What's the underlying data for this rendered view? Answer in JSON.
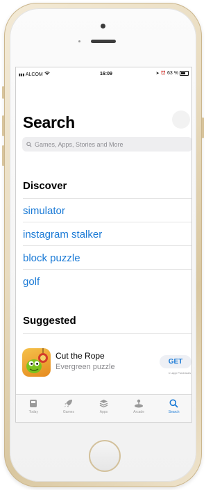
{
  "status": {
    "carrier": "ALCOM",
    "time": "16:09",
    "battery": "63 %"
  },
  "page": {
    "title": "Search"
  },
  "search": {
    "placeholder": "Games, Apps, Stories and More"
  },
  "discover": {
    "heading": "Discover",
    "items": [
      "simulator",
      "instagram stalker",
      "block puzzle",
      "golf"
    ]
  },
  "suggested": {
    "heading": "Suggested",
    "app": {
      "name": "Cut the Rope",
      "subtitle": "Evergreen puzzle",
      "button": "GET",
      "note": "In-App Purchases"
    }
  },
  "tabs": [
    {
      "label": "Today",
      "icon": "today-icon"
    },
    {
      "label": "Games",
      "icon": "rocket-icon"
    },
    {
      "label": "Apps",
      "icon": "layers-icon"
    },
    {
      "label": "Arcade",
      "icon": "joystick-icon"
    },
    {
      "label": "Search",
      "icon": "search-icon",
      "active": true
    }
  ],
  "colors": {
    "accent": "#1a7ad6",
    "phone_frame": "#e9dcc0"
  }
}
